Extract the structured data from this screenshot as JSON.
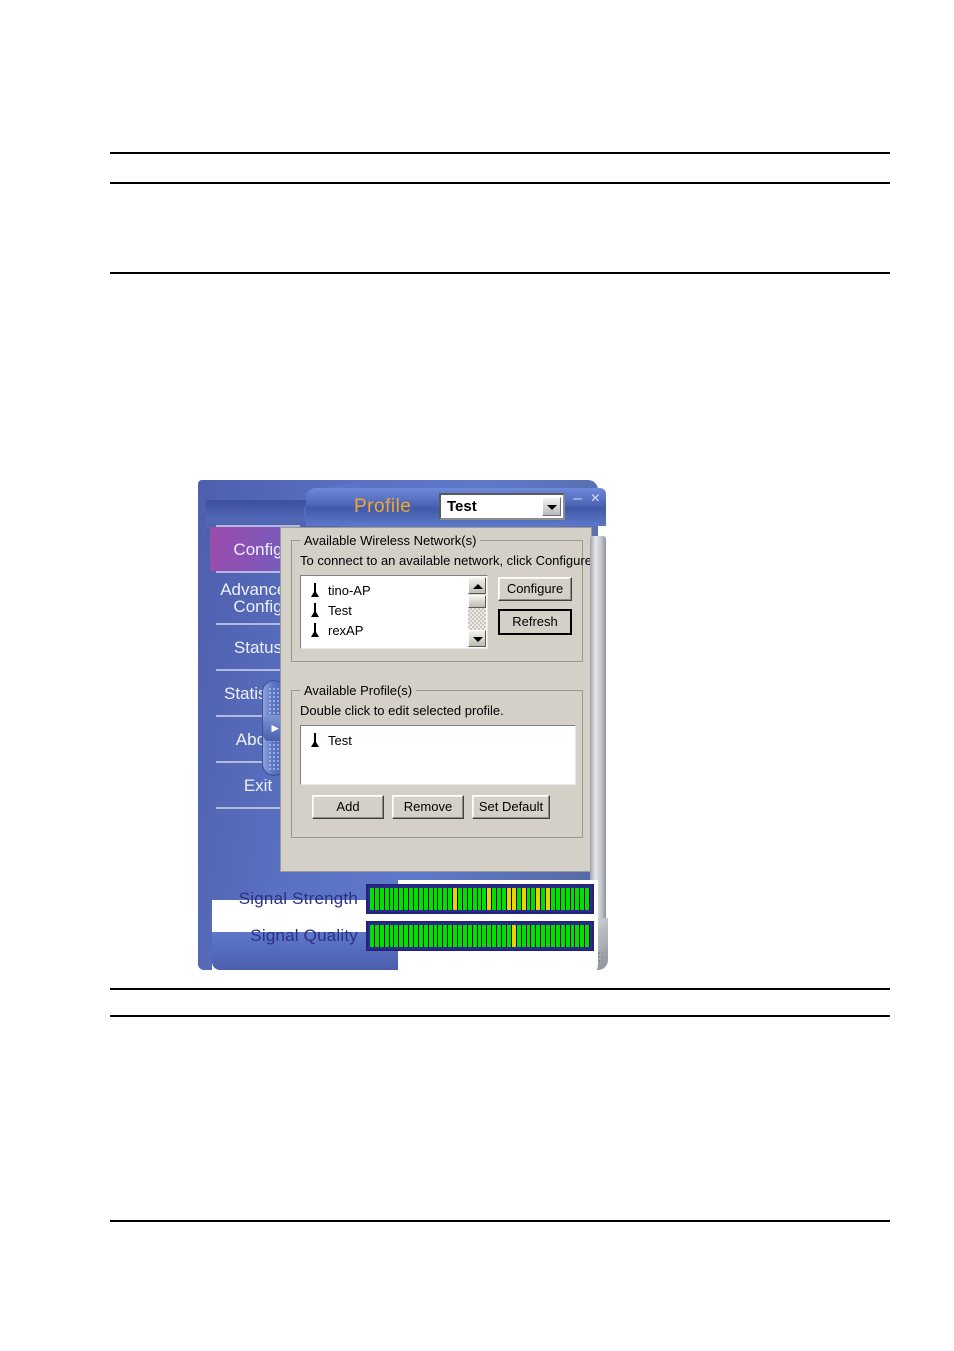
{
  "document": {
    "rules": [
      152,
      182,
      272,
      988,
      1015,
      1220
    ]
  },
  "app": {
    "titlebar": {
      "title_label": "Profile",
      "profile_selected": "Test",
      "profile_options": [
        "Test"
      ],
      "dropdown_icon": "chevron-down-icon",
      "minimize_label": "–",
      "close_label": "×",
      "title_color": "#f0a830"
    },
    "sidebar": {
      "items": [
        {
          "label": "Config",
          "active": true
        },
        {
          "label": "Advanced Config",
          "active": false
        },
        {
          "label": "Status",
          "active": false
        },
        {
          "label": "Statistics",
          "active": false
        },
        {
          "label": "About",
          "active": false
        },
        {
          "label": "Exit",
          "active": false
        }
      ],
      "pull_tab_icon": "chevron-right-icon",
      "active_color": "#9b4caa",
      "panel_color": "#5b72c2"
    },
    "networks_group": {
      "legend": "Available Wireless Network(s)",
      "hint": "To connect to an available network, click Configure.",
      "items": [
        {
          "name": "tino-AP",
          "icon": "access-point-icon"
        },
        {
          "name": "Test",
          "icon": "access-point-icon"
        },
        {
          "name": "rexAP",
          "icon": "access-point-icon"
        }
      ],
      "scrollbar": {
        "up_icon": "scroll-up-arrow-icon",
        "down_icon": "scroll-down-arrow-icon"
      },
      "configure_label": "Configure",
      "refresh_label": "Refresh"
    },
    "profiles_group": {
      "legend": "Available Profile(s)",
      "hint": "Double click to edit selected profile.",
      "items": [
        {
          "name": "Test",
          "icon": "access-point-icon"
        }
      ],
      "add_label": "Add",
      "remove_label": "Remove",
      "set_default_label": "Set Default"
    },
    "signal": {
      "strength_label": "Signal Strength",
      "quality_label": "Signal Quality",
      "bar_green": "#00e000",
      "bar_yellow": "#e8d400",
      "bar_background": "#000000",
      "frame_color": "#2b2b8f",
      "strength_segments": [
        "g",
        "g",
        "g",
        "g",
        "g",
        "g",
        "g",
        "g",
        "g",
        "g",
        "g",
        "g",
        "g",
        "g",
        "g",
        "g",
        "g",
        "y",
        "g",
        "g",
        "g",
        "g",
        "g",
        "g",
        "y",
        "g",
        "g",
        "g",
        "y",
        "y",
        "g",
        "y",
        "g",
        "g",
        "y",
        "g",
        "y",
        "g",
        "g",
        "g",
        "g",
        "g",
        "g",
        "g",
        "g"
      ],
      "quality_segments": [
        "g",
        "g",
        "g",
        "g",
        "g",
        "g",
        "g",
        "g",
        "g",
        "g",
        "g",
        "g",
        "g",
        "g",
        "g",
        "g",
        "g",
        "g",
        "g",
        "g",
        "g",
        "g",
        "g",
        "g",
        "g",
        "g",
        "g",
        "g",
        "g",
        "y",
        "g",
        "g",
        "g",
        "g",
        "g",
        "g",
        "g",
        "g",
        "g",
        "g",
        "g",
        "g",
        "g",
        "g",
        "g"
      ]
    }
  }
}
